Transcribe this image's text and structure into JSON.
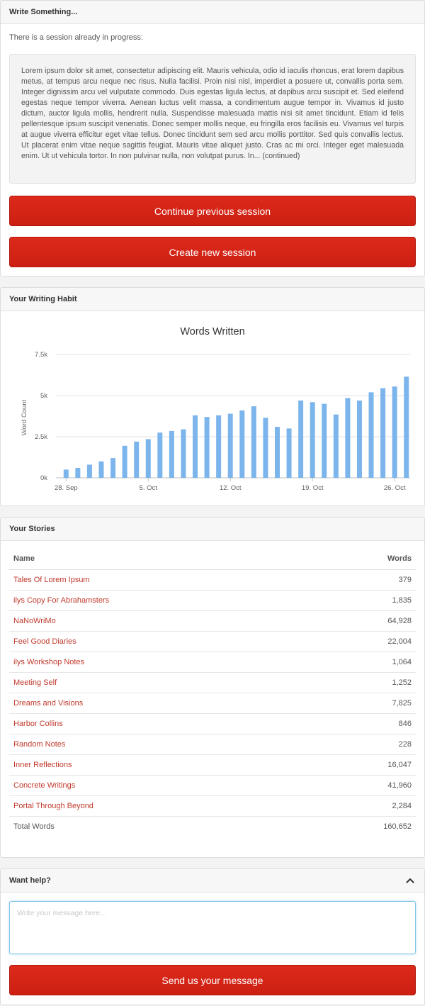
{
  "write": {
    "title": "Write Something...",
    "note": "There is a session already in progress:",
    "excerpt": "Lorem ipsum dolor sit amet, consectetur adipiscing elit. Mauris vehicula, odio id iaculis rhoncus, erat lorem dapibus metus, at tempus arcu neque nec risus. Nulla facilisi. Proin nisi nisl, imperdiet a posuere ut, convallis porta sem. Integer dignissim arcu vel vulputate commodo. Duis egestas ligula lectus, at dapibus arcu suscipit et. Sed eleifend egestas neque tempor viverra. Aenean luctus velit massa, a condimentum augue tempor in. Vivamus id justo dictum, auctor ligula mollis, hendrerit nulla. Suspendisse malesuada mattis nisi sit amet tincidunt. Etiam id felis pellentesque ipsum suscipit venenatis. Donec semper mollis neque, eu fringilla eros facilisis eu. Vivamus vel turpis at augue viverra efficitur eget vitae tellus. Donec tincidunt sem sed arcu mollis porttitor. Sed quis convallis lectus. Ut placerat enim vitae neque sagittis feugiat. Mauris vitae aliquet justo. Cras ac mi orci. Integer eget malesuada enim. Ut ut vehicula tortor. In non pulvinar nulla, non volutpat purus. In... (continued)",
    "continue_label": "Continue previous session",
    "create_label": "Create new session"
  },
  "habit": {
    "title": "Your Writing Habit"
  },
  "chart_data": {
    "type": "bar",
    "title": "Words Written",
    "xlabel": "",
    "ylabel": "Word Count",
    "ylim": [
      0,
      7500
    ],
    "ytick_labels": [
      "0k",
      "2.5k",
      "5k",
      "7.5k"
    ],
    "yticks": [
      0,
      2500,
      5000,
      7500
    ],
    "xtick_labels": [
      "28. Sep",
      "5. Oct",
      "12. Oct",
      "19. Oct",
      "26. Oct"
    ],
    "xtick_index": [
      0,
      7,
      14,
      21,
      28
    ],
    "color": "#7cb5ec",
    "categories": [
      "Sep 28",
      "Sep 29",
      "Sep 30",
      "Oct 1",
      "Oct 2",
      "Oct 3",
      "Oct 4",
      "Oct 5",
      "Oct 6",
      "Oct 7",
      "Oct 8",
      "Oct 9",
      "Oct 10",
      "Oct 11",
      "Oct 12",
      "Oct 13",
      "Oct 14",
      "Oct 15",
      "Oct 16",
      "Oct 17",
      "Oct 18",
      "Oct 19",
      "Oct 20",
      "Oct 21",
      "Oct 22",
      "Oct 23",
      "Oct 24",
      "Oct 25",
      "Oct 26",
      "Oct 27"
    ],
    "values": [
      500,
      600,
      800,
      1000,
      1200,
      1950,
      2200,
      2350,
      2750,
      2850,
      2950,
      3800,
      3700,
      3800,
      3900,
      4100,
      4350,
      3650,
      3100,
      3000,
      4700,
      4600,
      4500,
      3850,
      4850,
      4700,
      5200,
      5450,
      5550,
      6150
    ],
    "grid": true,
    "legend": "none"
  },
  "stories": {
    "title": "Your Stories",
    "col_name": "Name",
    "col_words": "Words",
    "rows": [
      {
        "name": "Tales Of Lorem Ipsum",
        "words": "379"
      },
      {
        "name": "ilys Copy For Abrahamsters",
        "words": "1,835"
      },
      {
        "name": "NaNoWriMo",
        "words": "64,928"
      },
      {
        "name": "Feel Good Diaries",
        "words": "22,004"
      },
      {
        "name": "ilys Workshop Notes",
        "words": "1,064"
      },
      {
        "name": "Meeting Self",
        "words": "1,252"
      },
      {
        "name": "Dreams and Visions",
        "words": "7,825"
      },
      {
        "name": "Harbor Collins",
        "words": "846"
      },
      {
        "name": "Random Notes",
        "words": "228"
      },
      {
        "name": "Inner Reflections",
        "words": "16,047"
      },
      {
        "name": "Concrete Writings",
        "words": "41,960"
      },
      {
        "name": "Portal Through Beyond",
        "words": "2,284"
      }
    ],
    "total_label": "Total Words",
    "total_value": "160,652"
  },
  "help": {
    "title": "Want help?",
    "placeholder": "Write your message here...",
    "send_label": "Send us your message",
    "collapse_icon": "chevron-up-icon"
  },
  "colors": {
    "accent": "#d22418",
    "link": "#c0392b",
    "bar": "#7cb5ec"
  }
}
